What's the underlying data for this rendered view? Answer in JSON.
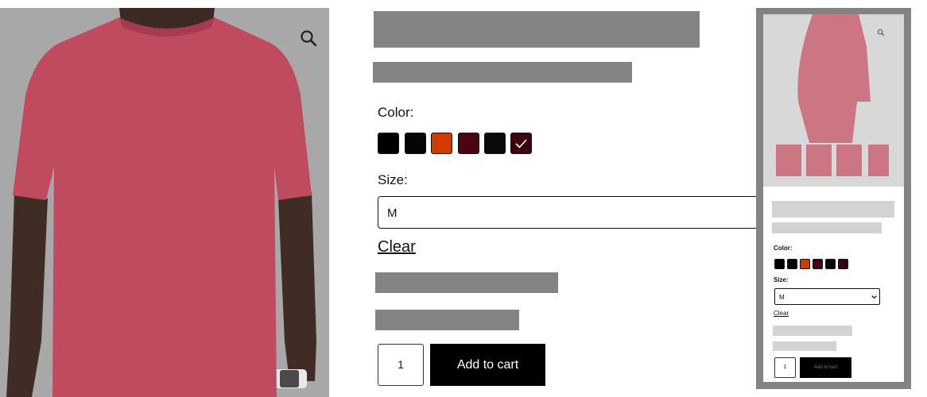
{
  "product": {
    "color_label": "Color:",
    "size_label": "Size:",
    "size_selected": "M",
    "clear_label": "Clear",
    "quantity": "1",
    "add_to_cart_label": "Add to cart",
    "swatches": [
      "#000000",
      "#050505",
      "#d23a00",
      "#4a0412",
      "#0a0a0a",
      "#3d0210"
    ],
    "selected_swatch_index": 5
  },
  "preview": {
    "color_label": "Color:",
    "size_label": "Size:",
    "size_selected": "M",
    "clear_label": "Clear",
    "quantity": "1",
    "add_to_cart_label": "Add to cart"
  },
  "colors": {
    "shirt": "#c04a5e",
    "skin": "#3a2a22",
    "image_bg": "#a8a8a8",
    "redaction": "#838383"
  },
  "icons": {
    "zoom": "magnifier-icon",
    "check": "checkmark-icon",
    "dropdown": "chevron-down-icon"
  }
}
